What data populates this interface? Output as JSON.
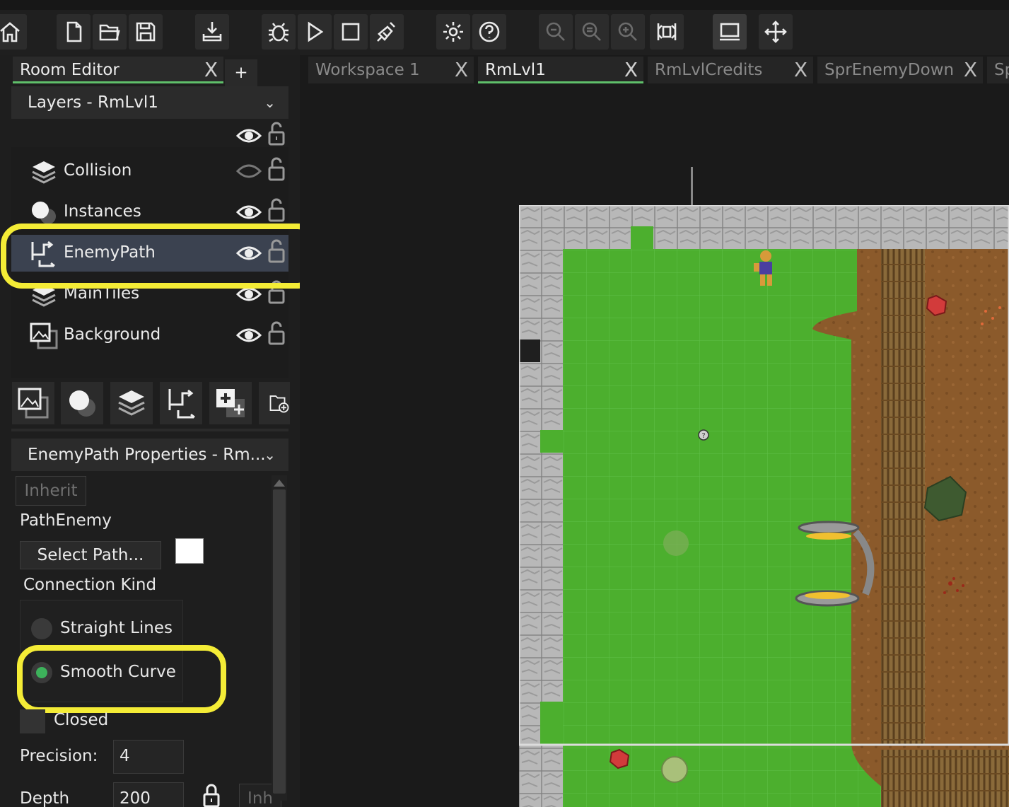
{
  "toolbar": {
    "buttons": [
      "home-icon",
      "new-file-icon",
      "open-folder-icon",
      "save-icon",
      "export-icon",
      "debug-icon",
      "run-icon",
      "stop-icon",
      "clean-icon",
      "settings-icon",
      "help-icon",
      "zoom-out-icon",
      "zoom-reset-icon",
      "zoom-in-icon",
      "fit-icon",
      "device-icon",
      "move-icon"
    ]
  },
  "left_tabs": {
    "room_editor": "Room Editor",
    "add": "+"
  },
  "layers": {
    "header": "Layers - RmLvl1",
    "items": [
      {
        "label": "Collision",
        "icon": "tileset-layer-icon",
        "visible": false
      },
      {
        "label": "Instances",
        "icon": "instance-layer-icon",
        "visible": true
      },
      {
        "label": "EnemyPath",
        "icon": "path-layer-icon",
        "visible": true,
        "selected": true
      },
      {
        "label": "MainTiles",
        "icon": "tileset-layer-icon",
        "visible": true
      },
      {
        "label": "Background",
        "icon": "background-layer-icon",
        "visible": true
      }
    ]
  },
  "properties": {
    "header": "EnemyPath Properties - Rm...",
    "inherit": "Inherit",
    "path_name": "PathEnemy",
    "select_path": "Select Path...",
    "connection_kind": "Connection Kind",
    "straight_lines": "Straight Lines",
    "smooth_curve": "Smooth Curve",
    "closed": "Closed",
    "precision_label": "Precision:",
    "precision_value": "4",
    "depth_label": "Depth",
    "depth_value": "200",
    "inherit_short": "Inh"
  },
  "editor_tabs": [
    {
      "label": "Workspace 1",
      "active": false
    },
    {
      "label": "RmLvl1",
      "active": true
    },
    {
      "label": "RmLvlCredits",
      "active": false
    },
    {
      "label": "SprEnemyDown",
      "active": false
    },
    {
      "label": "Sp",
      "active": false
    }
  ],
  "close_glyph": "X",
  "chevron": "⌄",
  "colors": {
    "highlight": "#f4ec36",
    "grass": "#4caf2e",
    "dirt": "#8b5a2b",
    "accent": "#5fbf6a"
  }
}
